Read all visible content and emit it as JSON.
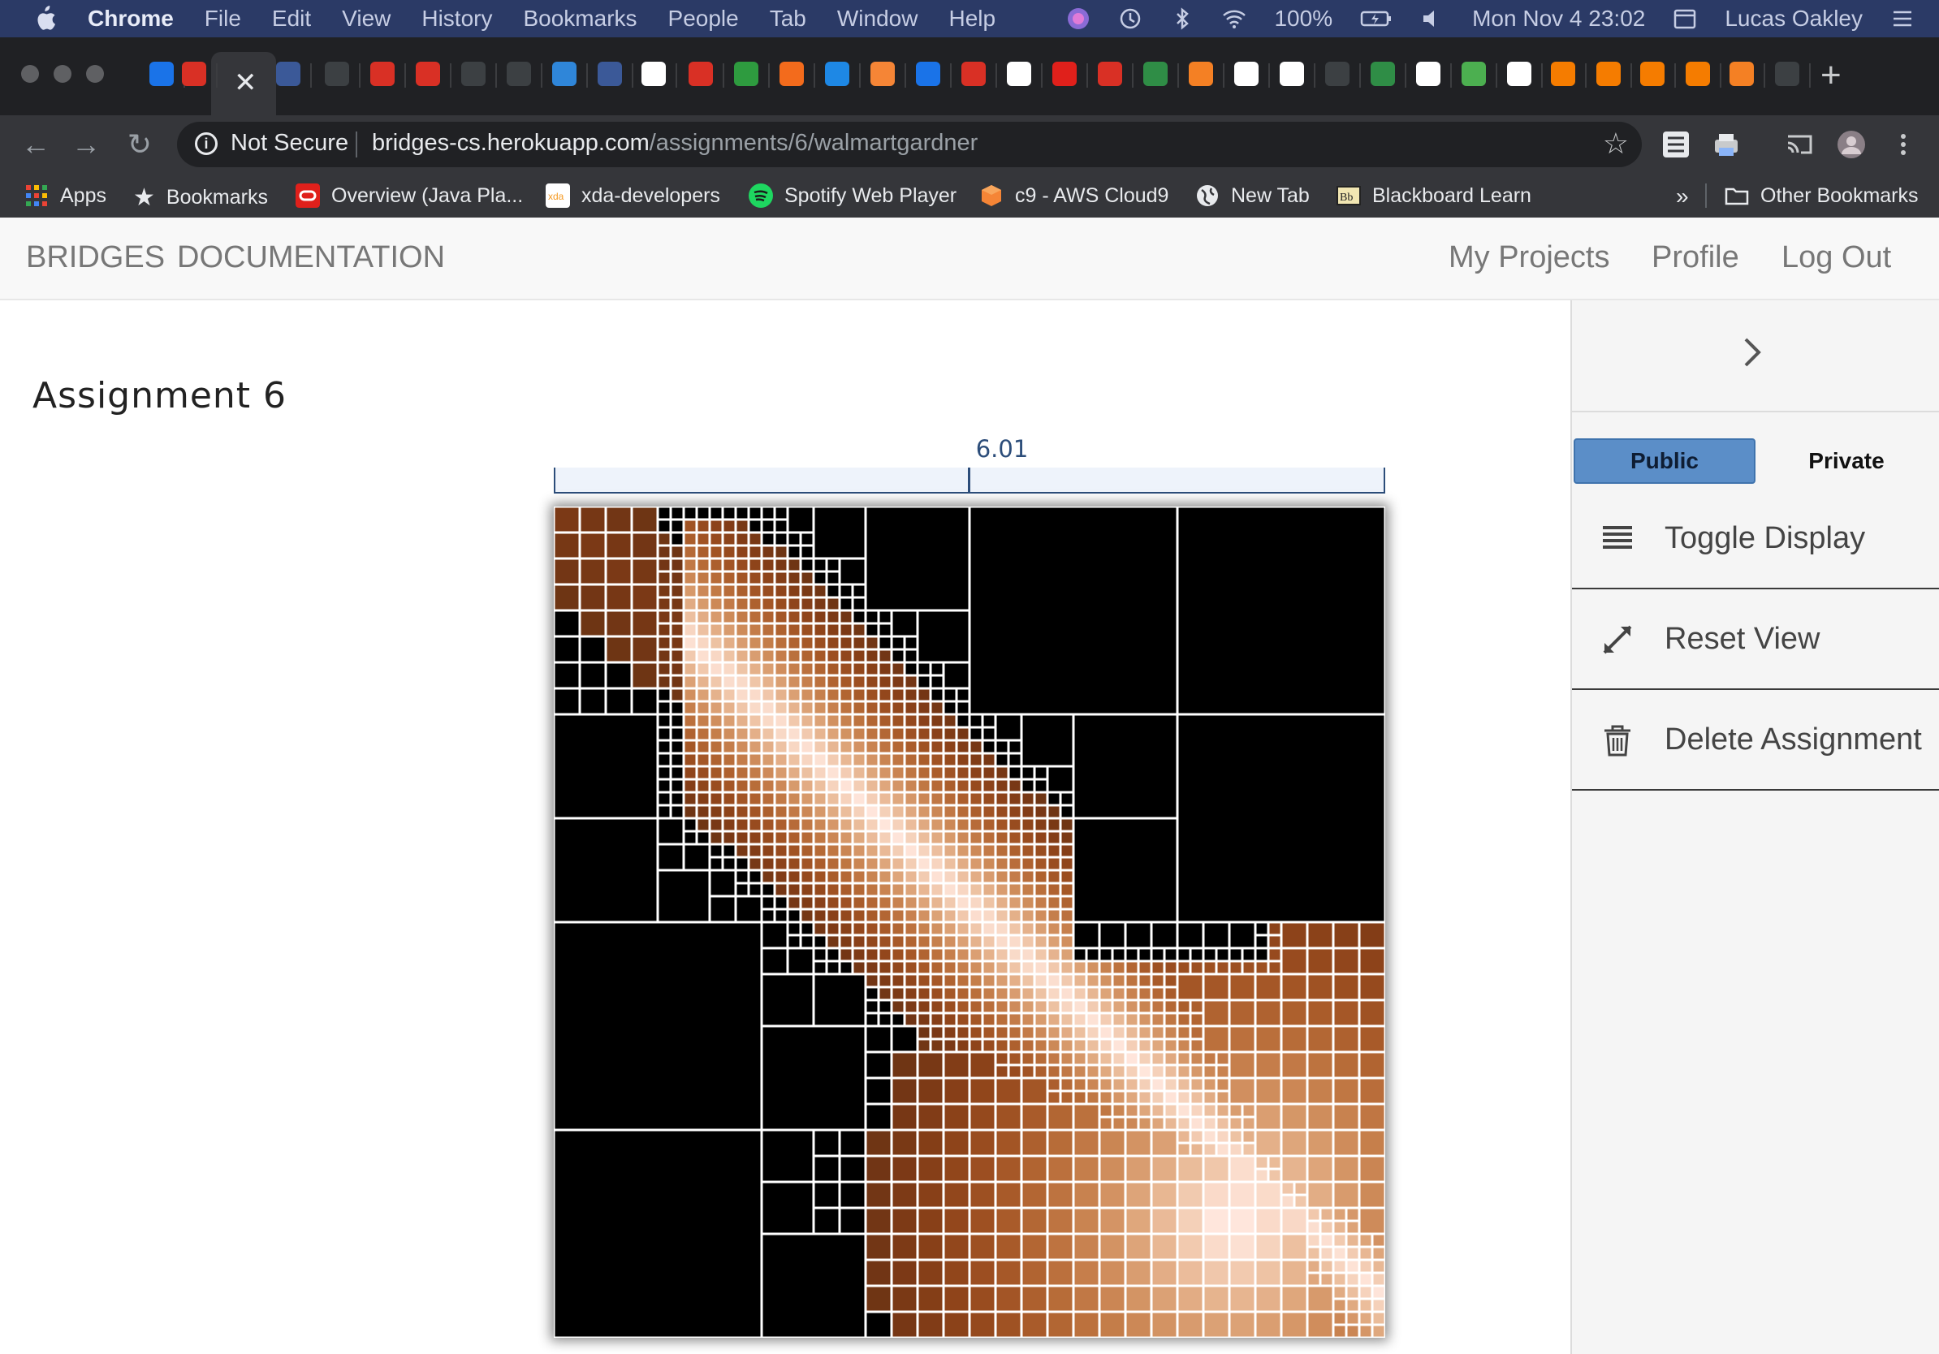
{
  "menubar": {
    "app_name": "Chrome",
    "items": [
      "File",
      "Edit",
      "View",
      "History",
      "Bookmarks",
      "People",
      "Tab",
      "Window",
      "Help"
    ],
    "battery": "100%",
    "clock": "Mon Nov 4  23:02",
    "user": "Lucas Oakley"
  },
  "browser": {
    "not_secure": "Not Secure",
    "url_host": "bridges-cs.herokuapp.com",
    "url_path": "/assignments/6/walmartgardner",
    "new_tab_glyph": "+",
    "bookmarks": [
      {
        "label": "Apps",
        "icon": "apps-grid-icon",
        "color": "#ea4335"
      },
      {
        "label": "Bookmarks",
        "icon": "star-icon",
        "color": "#e8eaed"
      },
      {
        "label": "Overview (Java Pla...",
        "icon": "oracle-icon",
        "color": "#e0201b"
      },
      {
        "label": "xda-developers",
        "icon": "xda-icon",
        "color": "#f59a23"
      },
      {
        "label": "Spotify Web Player",
        "icon": "spotify-icon",
        "color": "#1ed760"
      },
      {
        "label": "c9 - AWS Cloud9",
        "icon": "cloud9-icon",
        "color": "#f58536"
      },
      {
        "label": "New Tab",
        "icon": "globe-icon",
        "color": "#e8eaed"
      },
      {
        "label": "Blackboard Learn",
        "icon": "blackboard-icon",
        "color": "#f1e6b2"
      }
    ],
    "overflow": "»",
    "other_bookmarks": "Other Bookmarks"
  },
  "navbar": {
    "brand": "BRIDGES",
    "docs": "DOCUMENTATION",
    "my_projects": "My Projects",
    "profile": "Profile",
    "logout": "Log Out"
  },
  "assignment": {
    "title": "Assignment 6",
    "scale_value": "6.01"
  },
  "sidebar": {
    "public_label": "Public",
    "private_label": "Private",
    "toggle_display": "Toggle Display",
    "reset_view": "Reset View",
    "delete_assignment": "Delete Assignment"
  },
  "colors": {
    "public_button": "#5b8ec8",
    "scale_bar": "#2c4d7a",
    "menubar": "#2b3a66"
  }
}
